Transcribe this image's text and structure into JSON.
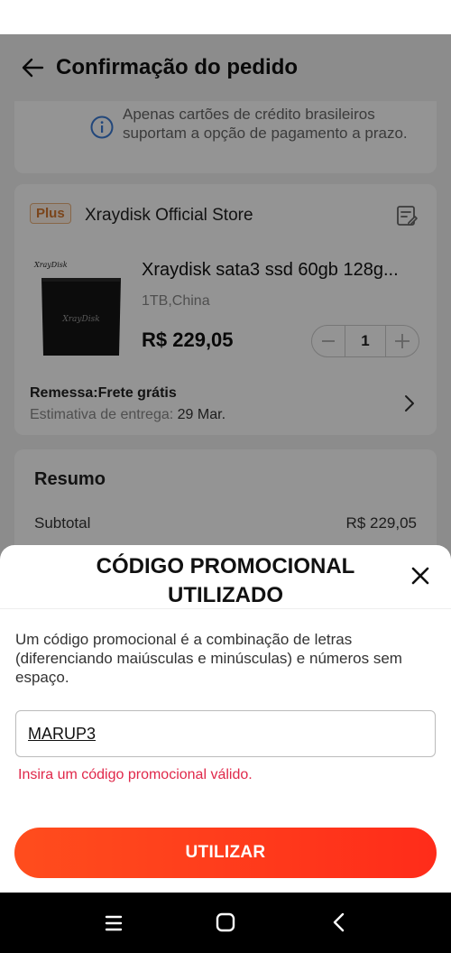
{
  "header": {
    "title": "Confirmação do pedido"
  },
  "info_notice": {
    "text": "Apenas cartões de crédito brasileiros suportam a opção de pagamento a prazo."
  },
  "store": {
    "badge": "Plus",
    "name": "Xraydisk Official Store",
    "product": {
      "title": "Xraydisk sata3 ssd 60gb 128g...",
      "variant": "1TB,China",
      "price": "R$ 229,05",
      "quantity": "1",
      "image_brand": "XrayDisk"
    },
    "shipping_label": "Remessa:",
    "shipping_value": "Frete grátis",
    "delivery_label": "Estimativa de entrega:",
    "delivery_date": "29 Mar."
  },
  "summary": {
    "title": "Resumo",
    "subtotal_label": "Subtotal",
    "subtotal_value": "R$ 229,05"
  },
  "promo_sheet": {
    "title": "CÓDIGO PROMOCIONAL UTILIZADO",
    "description": "Um código promocional é a combinação de letras (diferenciando maiúsculas e minúsculas) e números sem espaço.",
    "input_value": "MARUP3",
    "error": "Insira um código promocional válido.",
    "button_label": "UTILIZAR"
  },
  "colors": {
    "accent": "#ff3c1e",
    "error": "#e0284a",
    "plus_badge": "#d4772f"
  }
}
